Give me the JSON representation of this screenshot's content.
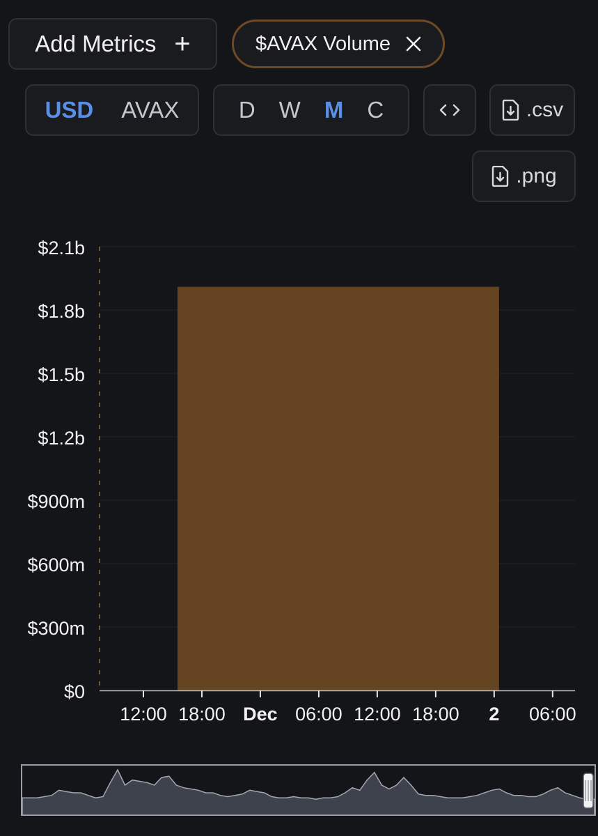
{
  "toolbar": {
    "add_metrics_label": "Add Metrics",
    "add_metrics_icon": "plus-icon",
    "metric_chip_label": "$AVAX Volume",
    "metric_chip_remove_icon": "close-icon",
    "currency_options": [
      "USD",
      "AVAX"
    ],
    "currency_selected": "USD",
    "period_options": [
      "D",
      "W",
      "M",
      "C"
    ],
    "period_selected": "M",
    "embed_icon": "code-icon",
    "csv_label": ".csv",
    "png_label": ".png",
    "download_icon": "file-download-icon"
  },
  "colors": {
    "background": "#141518",
    "bar": "#654421",
    "active_option": "#5b8fe6",
    "chip_border": "#6e4a25",
    "navigator_fill": "#3d424c"
  },
  "chart_data": {
    "type": "bar",
    "title": "",
    "xlabel": "",
    "ylabel": "",
    "y_tick_labels": [
      "$0",
      "$300m",
      "$600m",
      "$900m",
      "$1.2b",
      "$1.5b",
      "$1.8b",
      "$2.1b"
    ],
    "y_tick_values": [
      0,
      300000000,
      600000000,
      900000000,
      1200000000,
      1500000000,
      1800000000,
      2100000000
    ],
    "ylim": [
      0,
      2100000000
    ],
    "x_tick_labels": [
      "12:00",
      "18:00",
      "Dec",
      "06:00",
      "12:00",
      "18:00",
      "2",
      "06:00"
    ],
    "x_tick_bold": [
      false,
      false,
      true,
      false,
      false,
      false,
      true,
      false
    ],
    "x_tick_hours": [
      12,
      18,
      24,
      30,
      36,
      42,
      48,
      54
    ],
    "xlim_hours": [
      7.5,
      56.3
    ],
    "bars": [
      {
        "start_hour": 15.5,
        "end_hour": 48.5,
        "value": 1910000000
      }
    ],
    "grid": true,
    "navigator_series": [
      8,
      8,
      8,
      9,
      10,
      14,
      13,
      12,
      12,
      10,
      8,
      9,
      20,
      30,
      18,
      22,
      21,
      20,
      18,
      24,
      25,
      18,
      16,
      15,
      14,
      12,
      12,
      10,
      9,
      10,
      11,
      14,
      13,
      12,
      9,
      8,
      8,
      9,
      8,
      8,
      7,
      8,
      8,
      9,
      12,
      16,
      14,
      22,
      28,
      18,
      15,
      18,
      24,
      18,
      11,
      10,
      10,
      9,
      8,
      8,
      8,
      9,
      10,
      12,
      14,
      15,
      12,
      10,
      10,
      9,
      9,
      11,
      14,
      16,
      12,
      10,
      8,
      7,
      7
    ]
  }
}
